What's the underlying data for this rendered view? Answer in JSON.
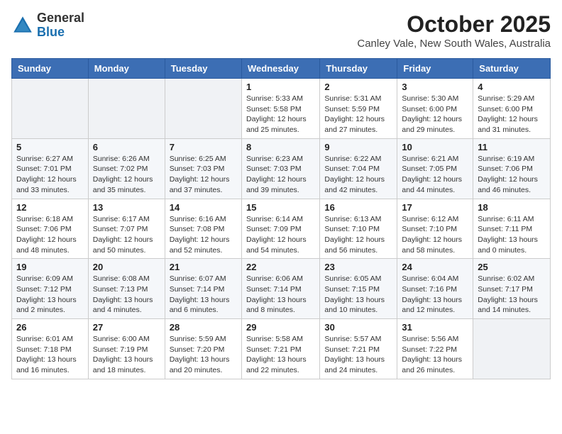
{
  "logo": {
    "general": "General",
    "blue": "Blue"
  },
  "header": {
    "month": "October 2025",
    "location": "Canley Vale, New South Wales, Australia"
  },
  "weekdays": [
    "Sunday",
    "Monday",
    "Tuesday",
    "Wednesday",
    "Thursday",
    "Friday",
    "Saturday"
  ],
  "weeks": [
    [
      {
        "day": "",
        "info": ""
      },
      {
        "day": "",
        "info": ""
      },
      {
        "day": "",
        "info": ""
      },
      {
        "day": "1",
        "info": "Sunrise: 5:33 AM\nSunset: 5:58 PM\nDaylight: 12 hours\nand 25 minutes."
      },
      {
        "day": "2",
        "info": "Sunrise: 5:31 AM\nSunset: 5:59 PM\nDaylight: 12 hours\nand 27 minutes."
      },
      {
        "day": "3",
        "info": "Sunrise: 5:30 AM\nSunset: 6:00 PM\nDaylight: 12 hours\nand 29 minutes."
      },
      {
        "day": "4",
        "info": "Sunrise: 5:29 AM\nSunset: 6:00 PM\nDaylight: 12 hours\nand 31 minutes."
      }
    ],
    [
      {
        "day": "5",
        "info": "Sunrise: 6:27 AM\nSunset: 7:01 PM\nDaylight: 12 hours\nand 33 minutes."
      },
      {
        "day": "6",
        "info": "Sunrise: 6:26 AM\nSunset: 7:02 PM\nDaylight: 12 hours\nand 35 minutes."
      },
      {
        "day": "7",
        "info": "Sunrise: 6:25 AM\nSunset: 7:03 PM\nDaylight: 12 hours\nand 37 minutes."
      },
      {
        "day": "8",
        "info": "Sunrise: 6:23 AM\nSunset: 7:03 PM\nDaylight: 12 hours\nand 39 minutes."
      },
      {
        "day": "9",
        "info": "Sunrise: 6:22 AM\nSunset: 7:04 PM\nDaylight: 12 hours\nand 42 minutes."
      },
      {
        "day": "10",
        "info": "Sunrise: 6:21 AM\nSunset: 7:05 PM\nDaylight: 12 hours\nand 44 minutes."
      },
      {
        "day": "11",
        "info": "Sunrise: 6:19 AM\nSunset: 7:06 PM\nDaylight: 12 hours\nand 46 minutes."
      }
    ],
    [
      {
        "day": "12",
        "info": "Sunrise: 6:18 AM\nSunset: 7:06 PM\nDaylight: 12 hours\nand 48 minutes."
      },
      {
        "day": "13",
        "info": "Sunrise: 6:17 AM\nSunset: 7:07 PM\nDaylight: 12 hours\nand 50 minutes."
      },
      {
        "day": "14",
        "info": "Sunrise: 6:16 AM\nSunset: 7:08 PM\nDaylight: 12 hours\nand 52 minutes."
      },
      {
        "day": "15",
        "info": "Sunrise: 6:14 AM\nSunset: 7:09 PM\nDaylight: 12 hours\nand 54 minutes."
      },
      {
        "day": "16",
        "info": "Sunrise: 6:13 AM\nSunset: 7:10 PM\nDaylight: 12 hours\nand 56 minutes."
      },
      {
        "day": "17",
        "info": "Sunrise: 6:12 AM\nSunset: 7:10 PM\nDaylight: 12 hours\nand 58 minutes."
      },
      {
        "day": "18",
        "info": "Sunrise: 6:11 AM\nSunset: 7:11 PM\nDaylight: 13 hours\nand 0 minutes."
      }
    ],
    [
      {
        "day": "19",
        "info": "Sunrise: 6:09 AM\nSunset: 7:12 PM\nDaylight: 13 hours\nand 2 minutes."
      },
      {
        "day": "20",
        "info": "Sunrise: 6:08 AM\nSunset: 7:13 PM\nDaylight: 13 hours\nand 4 minutes."
      },
      {
        "day": "21",
        "info": "Sunrise: 6:07 AM\nSunset: 7:14 PM\nDaylight: 13 hours\nand 6 minutes."
      },
      {
        "day": "22",
        "info": "Sunrise: 6:06 AM\nSunset: 7:14 PM\nDaylight: 13 hours\nand 8 minutes."
      },
      {
        "day": "23",
        "info": "Sunrise: 6:05 AM\nSunset: 7:15 PM\nDaylight: 13 hours\nand 10 minutes."
      },
      {
        "day": "24",
        "info": "Sunrise: 6:04 AM\nSunset: 7:16 PM\nDaylight: 13 hours\nand 12 minutes."
      },
      {
        "day": "25",
        "info": "Sunrise: 6:02 AM\nSunset: 7:17 PM\nDaylight: 13 hours\nand 14 minutes."
      }
    ],
    [
      {
        "day": "26",
        "info": "Sunrise: 6:01 AM\nSunset: 7:18 PM\nDaylight: 13 hours\nand 16 minutes."
      },
      {
        "day": "27",
        "info": "Sunrise: 6:00 AM\nSunset: 7:19 PM\nDaylight: 13 hours\nand 18 minutes."
      },
      {
        "day": "28",
        "info": "Sunrise: 5:59 AM\nSunset: 7:20 PM\nDaylight: 13 hours\nand 20 minutes."
      },
      {
        "day": "29",
        "info": "Sunrise: 5:58 AM\nSunset: 7:21 PM\nDaylight: 13 hours\nand 22 minutes."
      },
      {
        "day": "30",
        "info": "Sunrise: 5:57 AM\nSunset: 7:21 PM\nDaylight: 13 hours\nand 24 minutes."
      },
      {
        "day": "31",
        "info": "Sunrise: 5:56 AM\nSunset: 7:22 PM\nDaylight: 13 hours\nand 26 minutes."
      },
      {
        "day": "",
        "info": ""
      }
    ]
  ]
}
